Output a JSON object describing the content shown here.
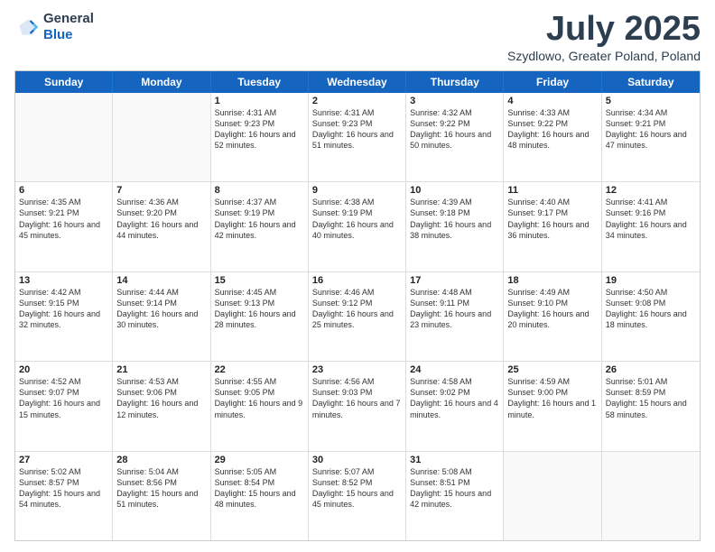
{
  "logo": {
    "general": "General",
    "blue": "Blue"
  },
  "header": {
    "month": "July 2025",
    "location": "Szydlowo, Greater Poland, Poland"
  },
  "weekdays": [
    "Sunday",
    "Monday",
    "Tuesday",
    "Wednesday",
    "Thursday",
    "Friday",
    "Saturday"
  ],
  "weeks": [
    [
      {
        "day": "",
        "sunrise": "",
        "sunset": "",
        "daylight": ""
      },
      {
        "day": "",
        "sunrise": "",
        "sunset": "",
        "daylight": ""
      },
      {
        "day": "1",
        "sunrise": "Sunrise: 4:31 AM",
        "sunset": "Sunset: 9:23 PM",
        "daylight": "Daylight: 16 hours and 52 minutes."
      },
      {
        "day": "2",
        "sunrise": "Sunrise: 4:31 AM",
        "sunset": "Sunset: 9:23 PM",
        "daylight": "Daylight: 16 hours and 51 minutes."
      },
      {
        "day": "3",
        "sunrise": "Sunrise: 4:32 AM",
        "sunset": "Sunset: 9:22 PM",
        "daylight": "Daylight: 16 hours and 50 minutes."
      },
      {
        "day": "4",
        "sunrise": "Sunrise: 4:33 AM",
        "sunset": "Sunset: 9:22 PM",
        "daylight": "Daylight: 16 hours and 48 minutes."
      },
      {
        "day": "5",
        "sunrise": "Sunrise: 4:34 AM",
        "sunset": "Sunset: 9:21 PM",
        "daylight": "Daylight: 16 hours and 47 minutes."
      }
    ],
    [
      {
        "day": "6",
        "sunrise": "Sunrise: 4:35 AM",
        "sunset": "Sunset: 9:21 PM",
        "daylight": "Daylight: 16 hours and 45 minutes."
      },
      {
        "day": "7",
        "sunrise": "Sunrise: 4:36 AM",
        "sunset": "Sunset: 9:20 PM",
        "daylight": "Daylight: 16 hours and 44 minutes."
      },
      {
        "day": "8",
        "sunrise": "Sunrise: 4:37 AM",
        "sunset": "Sunset: 9:19 PM",
        "daylight": "Daylight: 16 hours and 42 minutes."
      },
      {
        "day": "9",
        "sunrise": "Sunrise: 4:38 AM",
        "sunset": "Sunset: 9:19 PM",
        "daylight": "Daylight: 16 hours and 40 minutes."
      },
      {
        "day": "10",
        "sunrise": "Sunrise: 4:39 AM",
        "sunset": "Sunset: 9:18 PM",
        "daylight": "Daylight: 16 hours and 38 minutes."
      },
      {
        "day": "11",
        "sunrise": "Sunrise: 4:40 AM",
        "sunset": "Sunset: 9:17 PM",
        "daylight": "Daylight: 16 hours and 36 minutes."
      },
      {
        "day": "12",
        "sunrise": "Sunrise: 4:41 AM",
        "sunset": "Sunset: 9:16 PM",
        "daylight": "Daylight: 16 hours and 34 minutes."
      }
    ],
    [
      {
        "day": "13",
        "sunrise": "Sunrise: 4:42 AM",
        "sunset": "Sunset: 9:15 PM",
        "daylight": "Daylight: 16 hours and 32 minutes."
      },
      {
        "day": "14",
        "sunrise": "Sunrise: 4:44 AM",
        "sunset": "Sunset: 9:14 PM",
        "daylight": "Daylight: 16 hours and 30 minutes."
      },
      {
        "day": "15",
        "sunrise": "Sunrise: 4:45 AM",
        "sunset": "Sunset: 9:13 PM",
        "daylight": "Daylight: 16 hours and 28 minutes."
      },
      {
        "day": "16",
        "sunrise": "Sunrise: 4:46 AM",
        "sunset": "Sunset: 9:12 PM",
        "daylight": "Daylight: 16 hours and 25 minutes."
      },
      {
        "day": "17",
        "sunrise": "Sunrise: 4:48 AM",
        "sunset": "Sunset: 9:11 PM",
        "daylight": "Daylight: 16 hours and 23 minutes."
      },
      {
        "day": "18",
        "sunrise": "Sunrise: 4:49 AM",
        "sunset": "Sunset: 9:10 PM",
        "daylight": "Daylight: 16 hours and 20 minutes."
      },
      {
        "day": "19",
        "sunrise": "Sunrise: 4:50 AM",
        "sunset": "Sunset: 9:08 PM",
        "daylight": "Daylight: 16 hours and 18 minutes."
      }
    ],
    [
      {
        "day": "20",
        "sunrise": "Sunrise: 4:52 AM",
        "sunset": "Sunset: 9:07 PM",
        "daylight": "Daylight: 16 hours and 15 minutes."
      },
      {
        "day": "21",
        "sunrise": "Sunrise: 4:53 AM",
        "sunset": "Sunset: 9:06 PM",
        "daylight": "Daylight: 16 hours and 12 minutes."
      },
      {
        "day": "22",
        "sunrise": "Sunrise: 4:55 AM",
        "sunset": "Sunset: 9:05 PM",
        "daylight": "Daylight: 16 hours and 9 minutes."
      },
      {
        "day": "23",
        "sunrise": "Sunrise: 4:56 AM",
        "sunset": "Sunset: 9:03 PM",
        "daylight": "Daylight: 16 hours and 7 minutes."
      },
      {
        "day": "24",
        "sunrise": "Sunrise: 4:58 AM",
        "sunset": "Sunset: 9:02 PM",
        "daylight": "Daylight: 16 hours and 4 minutes."
      },
      {
        "day": "25",
        "sunrise": "Sunrise: 4:59 AM",
        "sunset": "Sunset: 9:00 PM",
        "daylight": "Daylight: 16 hours and 1 minute."
      },
      {
        "day": "26",
        "sunrise": "Sunrise: 5:01 AM",
        "sunset": "Sunset: 8:59 PM",
        "daylight": "Daylight: 15 hours and 58 minutes."
      }
    ],
    [
      {
        "day": "27",
        "sunrise": "Sunrise: 5:02 AM",
        "sunset": "Sunset: 8:57 PM",
        "daylight": "Daylight: 15 hours and 54 minutes."
      },
      {
        "day": "28",
        "sunrise": "Sunrise: 5:04 AM",
        "sunset": "Sunset: 8:56 PM",
        "daylight": "Daylight: 15 hours and 51 minutes."
      },
      {
        "day": "29",
        "sunrise": "Sunrise: 5:05 AM",
        "sunset": "Sunset: 8:54 PM",
        "daylight": "Daylight: 15 hours and 48 minutes."
      },
      {
        "day": "30",
        "sunrise": "Sunrise: 5:07 AM",
        "sunset": "Sunset: 8:52 PM",
        "daylight": "Daylight: 15 hours and 45 minutes."
      },
      {
        "day": "31",
        "sunrise": "Sunrise: 5:08 AM",
        "sunset": "Sunset: 8:51 PM",
        "daylight": "Daylight: 15 hours and 42 minutes."
      },
      {
        "day": "",
        "sunrise": "",
        "sunset": "",
        "daylight": ""
      },
      {
        "day": "",
        "sunrise": "",
        "sunset": "",
        "daylight": ""
      }
    ]
  ]
}
